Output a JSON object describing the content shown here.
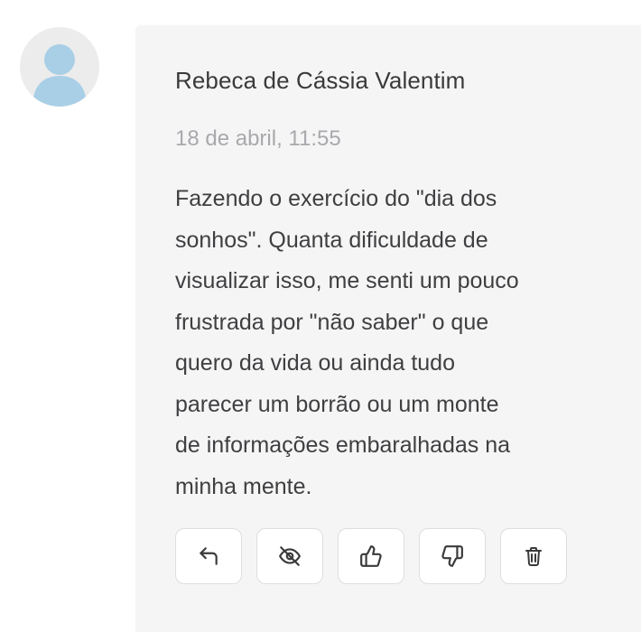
{
  "comment": {
    "author": "Rebeca de Cássia Valentim",
    "timestamp": "18 de abril, 11:55",
    "body_lines": [
      "Fazendo o exercício do \"dia dos",
      "sonhos\". Quanta dificuldade de",
      "visualizar isso, me senti um pouco",
      "frustrada por \"não saber\" o que",
      "quero da vida ou ainda tudo",
      "parecer um borrão ou um monte",
      "de informações embaralhadas na",
      "minha mente."
    ]
  },
  "actions": [
    {
      "icon": "reply-icon"
    },
    {
      "icon": "eye-off-icon"
    },
    {
      "icon": "thumbs-up-icon"
    },
    {
      "icon": "thumbs-down-icon"
    },
    {
      "icon": "trash-icon"
    }
  ],
  "colors": {
    "card_background": "#f5f5f6",
    "author_text": "#3a3a3a",
    "timestamp_text": "#a9a9ad",
    "body_text": "#3f3f41",
    "avatar_silhouette": "#a9cfe6",
    "button_border": "#dedee1"
  }
}
